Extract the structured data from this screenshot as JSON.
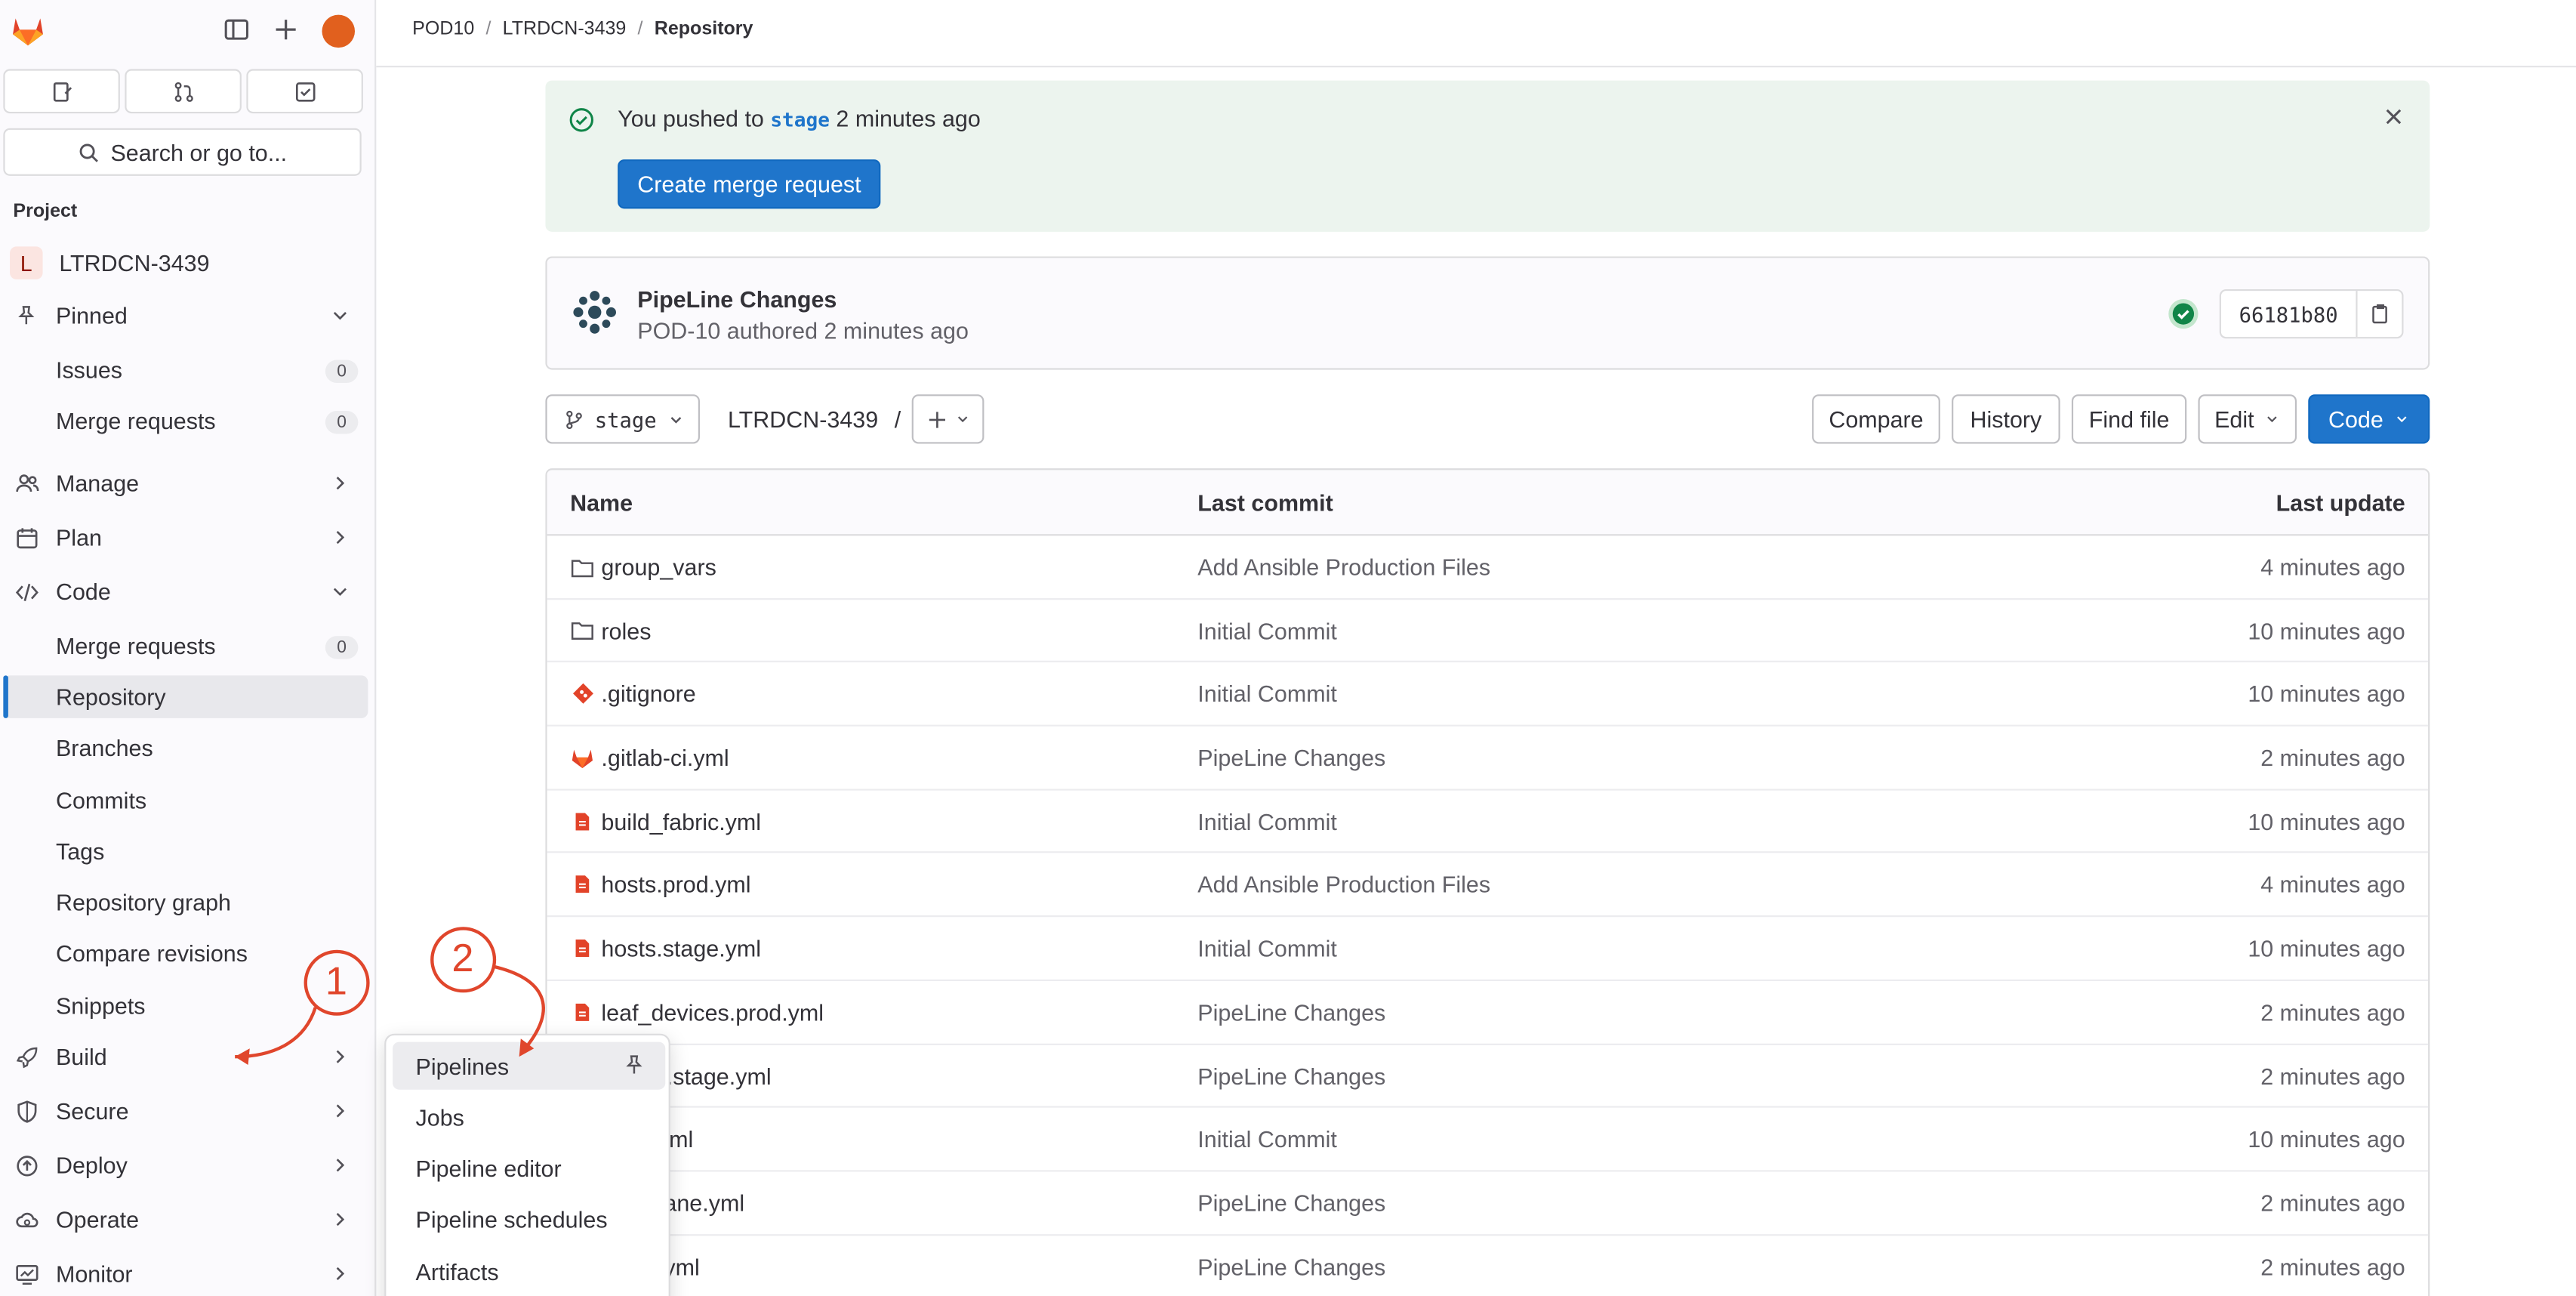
{
  "breadcrumbs": [
    {
      "label": "POD10"
    },
    {
      "label": "LTRDCN-3439"
    },
    {
      "label": "Repository"
    }
  ],
  "sidebar": {
    "search_label": "Search or go to...",
    "section_label": "Project",
    "project_letter": "L",
    "project_name": "LTRDCN-3439",
    "pinned_label": "Pinned",
    "pinned_items": [
      {
        "label": "Issues",
        "count": "0"
      },
      {
        "label": "Merge requests",
        "count": "0"
      }
    ],
    "manage_label": "Manage",
    "plan_label": "Plan",
    "code_label": "Code",
    "code_items": [
      {
        "label": "Merge requests",
        "count": "0"
      },
      {
        "label": "Repository"
      },
      {
        "label": "Branches"
      },
      {
        "label": "Commits"
      },
      {
        "label": "Tags"
      },
      {
        "label": "Repository graph"
      },
      {
        "label": "Compare revisions"
      },
      {
        "label": "Snippets"
      }
    ],
    "build_label": "Build",
    "secure_label": "Secure",
    "deploy_label": "Deploy",
    "operate_label": "Operate",
    "monitor_label": "Monitor"
  },
  "alert": {
    "text_before": "You pushed to ",
    "branch": "stage",
    "text_after": " 2 minutes ago",
    "button_label": "Create merge request"
  },
  "commit": {
    "title": "PipeLine Changes",
    "subtitle": "POD-10 authored 2 minutes ago",
    "sha": "66181b80"
  },
  "toolbar": {
    "branch": "stage",
    "path": "LTRDCN-3439",
    "path_sep": "/",
    "compare": "Compare",
    "history": "History",
    "find_file": "Find file",
    "edit": "Edit",
    "code": "Code"
  },
  "table": {
    "headers": {
      "name": "Name",
      "commit": "Last commit",
      "update": "Last update"
    },
    "rows": [
      {
        "name": "group_vars",
        "icon": "folder-icon",
        "commit": "Add Ansible Production Files",
        "update": "4 minutes ago"
      },
      {
        "name": "roles",
        "icon": "folder-icon",
        "commit": "Initial Commit",
        "update": "10 minutes ago"
      },
      {
        "name": ".gitignore",
        "icon": "git-icon",
        "commit": "Initial Commit",
        "update": "10 minutes ago"
      },
      {
        "name": ".gitlab-ci.yml",
        "icon": "gitlab-icon",
        "commit": "PipeLine Changes",
        "update": "2 minutes ago"
      },
      {
        "name": "build_fabric.yml",
        "icon": "yaml-file-icon",
        "commit": "Initial Commit",
        "update": "10 minutes ago"
      },
      {
        "name": "hosts.prod.yml",
        "icon": "yaml-file-icon",
        "commit": "Add Ansible Production Files",
        "update": "4 minutes ago"
      },
      {
        "name": "hosts.stage.yml",
        "icon": "yaml-file-icon",
        "commit": "Initial Commit",
        "update": "10 minutes ago"
      },
      {
        "name": "leaf_devices.prod.yml",
        "icon": "yaml-file-icon",
        "commit": "PipeLine Changes",
        "update": "2 minutes ago"
      },
      {
        "name": "evices.stage.yml",
        "icon": "yaml-file-icon",
        "commit": "PipeLine Changes",
        "update": "2 minutes ago"
      },
      {
        "name": "abric.yml",
        "icon": "yaml-file-icon",
        "commit": "Initial Commit",
        "update": "10 minutes ago"
      },
      {
        "name": "dataplane.yml",
        "icon": "yaml-file-icon",
        "commit": "PipeLine Changes",
        "update": "2 minutes ago"
      },
      {
        "name": "fabric.yml",
        "icon": "yaml-file-icon",
        "commit": "PipeLine Changes",
        "update": "2 minutes ago"
      }
    ]
  },
  "build_menu": {
    "items": [
      {
        "label": "Pipelines"
      },
      {
        "label": "Jobs"
      },
      {
        "label": "Pipeline editor"
      },
      {
        "label": "Pipeline schedules"
      },
      {
        "label": "Artifacts"
      }
    ]
  },
  "annotations": {
    "step1": "1",
    "step2": "2",
    "color": "#e0462c"
  },
  "colors": {
    "accent": "#1f75cb",
    "success_bg": "#ecf4ee",
    "success": "#108548",
    "annotation": "#e0462c"
  }
}
